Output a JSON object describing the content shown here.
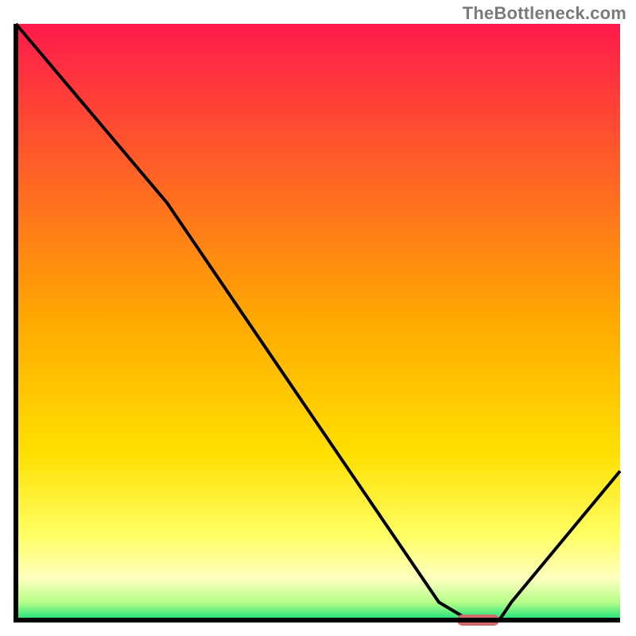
{
  "watermark": "TheBottleneck.com",
  "chart_data": {
    "type": "line",
    "title": "",
    "xlabel": "",
    "ylabel": "",
    "xlim": [
      0,
      100
    ],
    "ylim": [
      0,
      100
    ],
    "x": [
      0,
      25,
      70,
      75,
      80,
      82,
      100
    ],
    "values": [
      100,
      70,
      3,
      0,
      0,
      3,
      25
    ],
    "marker": {
      "x_start": 73,
      "x_end": 80,
      "y": 0,
      "color": "#d16a6a"
    },
    "gradient_stops": [
      {
        "offset": 0.0,
        "color": "#ff1a4b"
      },
      {
        "offset": 0.5,
        "color": "#ffaa00"
      },
      {
        "offset": 0.72,
        "color": "#ffe000"
      },
      {
        "offset": 0.86,
        "color": "#ffff66"
      },
      {
        "offset": 0.93,
        "color": "#ffffc0"
      },
      {
        "offset": 0.97,
        "color": "#b6ff8a"
      },
      {
        "offset": 1.0,
        "color": "#16e07a"
      }
    ],
    "line_color": "#000000",
    "axis_color": "#000000"
  }
}
